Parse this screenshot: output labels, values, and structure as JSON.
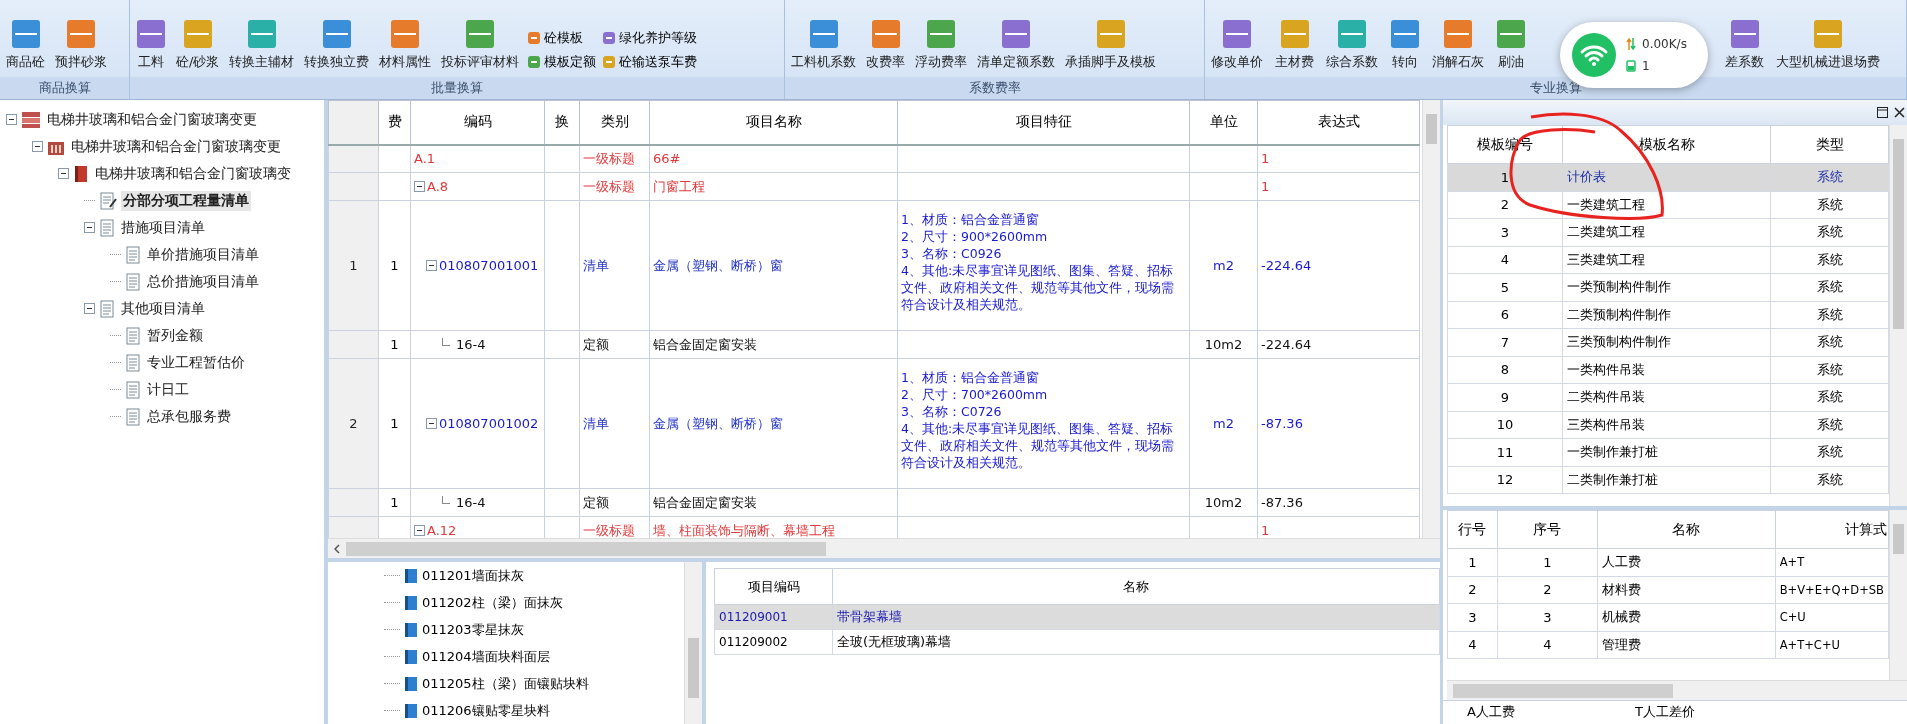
{
  "ribbon": {
    "groups": [
      {
        "label": "商品换算",
        "buttons": [
          {
            "label": "商品砼"
          },
          {
            "label": "预拌砂浆"
          }
        ]
      },
      {
        "label": "批量换算",
        "buttons": [
          {
            "label": "工料"
          },
          {
            "label": "砼/砂浆"
          },
          {
            "label": "转换主辅材"
          },
          {
            "label": "转换独立费"
          },
          {
            "label": "材料属性"
          },
          {
            "label": "投标评审材料"
          }
        ],
        "small_buttons": [
          {
            "label": "砼模板"
          },
          {
            "label": "模板定额"
          },
          {
            "label": "绿化养护等级"
          },
          {
            "label": "砼输送泵车费"
          }
        ]
      },
      {
        "label": "系数费率",
        "buttons": [
          {
            "label": "工料机系数"
          },
          {
            "label": "改费率"
          },
          {
            "label": "浮动费率"
          },
          {
            "label": "清单定额系数"
          },
          {
            "label": "承插脚手及模板"
          }
        ]
      },
      {
        "label": "专业换算",
        "buttons": [
          {
            "label": "修改单价"
          },
          {
            "label": "主材费"
          },
          {
            "label": "综合系数"
          },
          {
            "label": "转向"
          },
          {
            "label": "消解石灰"
          },
          {
            "label": "刷油"
          },
          {
            "label": "差系数"
          },
          {
            "label": "大型机械进退场费"
          }
        ]
      }
    ]
  },
  "network_popup": {
    "speed": "0.00K/s",
    "count": "1"
  },
  "project_tree": [
    {
      "label": "电梯井玻璃和铝合金门窗玻璃变更",
      "kind": "project",
      "expanded": true,
      "selected": false,
      "children": [
        {
          "label": "电梯井玻璃和铝合金门窗玻璃变更",
          "kind": "building",
          "expanded": true,
          "selected": false,
          "children": [
            {
              "label": "电梯井玻璃和铝合金门窗玻璃变",
              "kind": "unit",
              "expanded": true,
              "selected": false,
              "children": [
                {
                  "label": "分部分项工程量清单",
                  "kind": "edit",
                  "selected": true
                },
                {
                  "label": "措施项目清单",
                  "kind": "doc",
                  "expanded": true,
                  "selected": false,
                  "children": [
                    {
                      "label": "单价措施项目清单",
                      "kind": "doc",
                      "selected": false
                    },
                    {
                      "label": "总价措施项目清单",
                      "kind": "doc",
                      "selected": false
                    }
                  ]
                },
                {
                  "label": "其他项目清单",
                  "kind": "doc",
                  "expanded": true,
                  "selected": false,
                  "children": [
                    {
                      "label": "暂列金额",
                      "kind": "doc",
                      "selected": false
                    },
                    {
                      "label": "专业工程暂估价",
                      "kind": "doc",
                      "selected": false
                    },
                    {
                      "label": "计日工",
                      "kind": "doc",
                      "selected": false
                    },
                    {
                      "label": "总承包服务费",
                      "kind": "doc",
                      "selected": false
                    }
                  ]
                }
              ]
            }
          ]
        }
      ]
    }
  ],
  "bill_table": {
    "columns": [
      "费",
      "编码",
      "换",
      "类别",
      "项目名称",
      "项目特征",
      "单位",
      "表达式"
    ],
    "rows": [
      {
        "kind": "heading",
        "code": "A.1",
        "category": "一级标题",
        "name": "66#",
        "expression": "1"
      },
      {
        "kind": "heading",
        "code": "A.8",
        "expanded": true,
        "category": "一级标题",
        "name": "门窗工程",
        "expression": "1"
      },
      {
        "kind": "list",
        "number": "1",
        "fee": "1",
        "code": "010807001001",
        "expanded": true,
        "category": "清单",
        "name": "金属（塑钢、断桥）窗",
        "features": "1、材质：铝合金普通窗\n2、尺寸：900*2600mm\n3、名称：C0926\n4、其他:未尽事宜详见图纸、图集、答疑、招标文件、政府相关文件、规范等其他文件，现场需符合设计及相关规范。",
        "unit": "m2",
        "expression": "-224.64"
      },
      {
        "kind": "quota",
        "fee": "1",
        "code": "16-4",
        "category": "定额",
        "name": "铝合金固定窗安装",
        "unit": "10m2",
        "expression": "-224.64"
      },
      {
        "kind": "list",
        "number": "2",
        "fee": "1",
        "code": "010807001002",
        "expanded": true,
        "category": "清单",
        "name": "金属（塑钢、断桥）窗",
        "features": "1、材质：铝合金普通窗\n2、尺寸：700*2600mm\n3、名称：C0726\n4、其他:未尽事宜详见图纸、图集、答疑、招标文件、政府相关文件、规范等其他文件，现场需符合设计及相关规范。",
        "unit": "m2",
        "expression": "-87.36"
      },
      {
        "kind": "quota",
        "fee": "1",
        "code": "16-4",
        "category": "定额",
        "name": "铝合金固定窗安装",
        "unit": "10m2",
        "expression": "-87.36"
      },
      {
        "kind": "heading",
        "code": "A.12",
        "expanded": true,
        "category": "一级标题",
        "name": "墙、柱面装饰与隔断、幕墙工程",
        "expression": "1"
      }
    ]
  },
  "chapter_list": [
    {
      "label": "011201墙面抹灰"
    },
    {
      "label": "011202柱（梁）面抹灰"
    },
    {
      "label": "011203零星抹灰"
    },
    {
      "label": "011204墙面块料面层"
    },
    {
      "label": "011205柱（梁）面镶贴块料"
    },
    {
      "label": "011206镶贴零星块料"
    }
  ],
  "chapter_table": {
    "columns": [
      "项目编码",
      "名称"
    ],
    "rows": [
      {
        "code": "011209001",
        "name": "带骨架幕墙",
        "selected": true
      },
      {
        "code": "011209002",
        "name": "全玻(无框玻璃)幕墙",
        "selected": false
      }
    ]
  },
  "template_table": {
    "columns": [
      "模板编号",
      "模板名称",
      "类型"
    ],
    "rows": [
      {
        "number": "1",
        "name": "计价表",
        "type": "系统",
        "selected": true
      },
      {
        "number": "2",
        "name": "一类建筑工程",
        "type": "系统",
        "selected": false
      },
      {
        "number": "3",
        "name": "二类建筑工程",
        "type": "系统",
        "selected": false
      },
      {
        "number": "4",
        "name": "三类建筑工程",
        "type": "系统",
        "selected": false
      },
      {
        "number": "5",
        "name": "一类预制构件制作",
        "type": "系统",
        "selected": false
      },
      {
        "number": "6",
        "name": "二类预制构件制作",
        "type": "系统",
        "selected": false
      },
      {
        "number": "7",
        "name": "三类预制构件制作",
        "type": "系统",
        "selected": false
      },
      {
        "number": "8",
        "name": "一类构件吊装",
        "type": "系统",
        "selected": false
      },
      {
        "number": "9",
        "name": "二类构件吊装",
        "type": "系统",
        "selected": false
      },
      {
        "number": "10",
        "name": "三类构件吊装",
        "type": "系统",
        "selected": false
      },
      {
        "number": "11",
        "name": "一类制作兼打桩",
        "type": "系统",
        "selected": false
      },
      {
        "number": "12",
        "name": "二类制作兼打桩",
        "type": "系统",
        "selected": false
      }
    ]
  },
  "cost_table": {
    "columns": [
      "行号",
      "序号",
      "名称",
      "计算式"
    ],
    "rows": [
      {
        "line": "1",
        "seq": "1",
        "name": "人工费",
        "formula": "A+T"
      },
      {
        "line": "2",
        "seq": "2",
        "name": "材料费",
        "formula": "B+V+E+Q+D+SB"
      },
      {
        "line": "3",
        "seq": "3",
        "name": "机械费",
        "formula": "C+U"
      },
      {
        "line": "4",
        "seq": "4",
        "name": "管理费",
        "formula": "A+T+C+U"
      }
    ]
  },
  "legend": [
    "A人工费",
    "T人工差价"
  ]
}
